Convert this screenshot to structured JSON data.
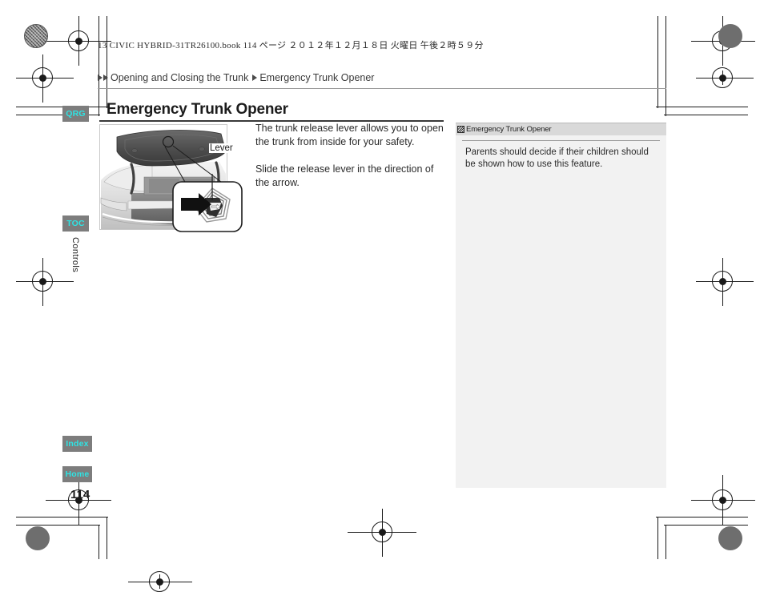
{
  "document": {
    "book_header": "13 CIVIC HYBRID-31TR26100.book   114 ページ   ２０１２年１２月１８日   火曜日   午後２時５９分",
    "page_number": "114",
    "chapter_label": "Controls"
  },
  "breadcrumb": {
    "parent": "Opening and Closing the Trunk",
    "current": "Emergency Trunk Opener",
    "arrow_icon": "triangle-right-icon"
  },
  "section": {
    "title": "Emergency Trunk Opener"
  },
  "body": {
    "paragraphs": [
      "The trunk release lever allows you to open the trunk from inside for your safety.",
      "Slide the release lever in the direction of the arrow."
    ]
  },
  "figure": {
    "callout_label": "Lever",
    "alt": "Open trunk interior with callout to emergency release lever and arrow showing slide direction"
  },
  "note": {
    "icon": "note-marker-icon",
    "title": "Emergency Trunk Opener",
    "text": "Parents should decide if their children should be shown how to use this feature."
  },
  "side_tabs": [
    {
      "id": "qrg",
      "label": "QRG"
    },
    {
      "id": "toc",
      "label": "TOC"
    },
    {
      "id": "index",
      "label": "Index"
    },
    {
      "id": "home",
      "label": "Home"
    }
  ],
  "colors": {
    "tab_background": "#7d7d7d",
    "tab_text": "#2fe3e3",
    "note_background": "#f2f2f2",
    "note_header": "#d9d9d9",
    "rule": "#9b9b9b"
  }
}
